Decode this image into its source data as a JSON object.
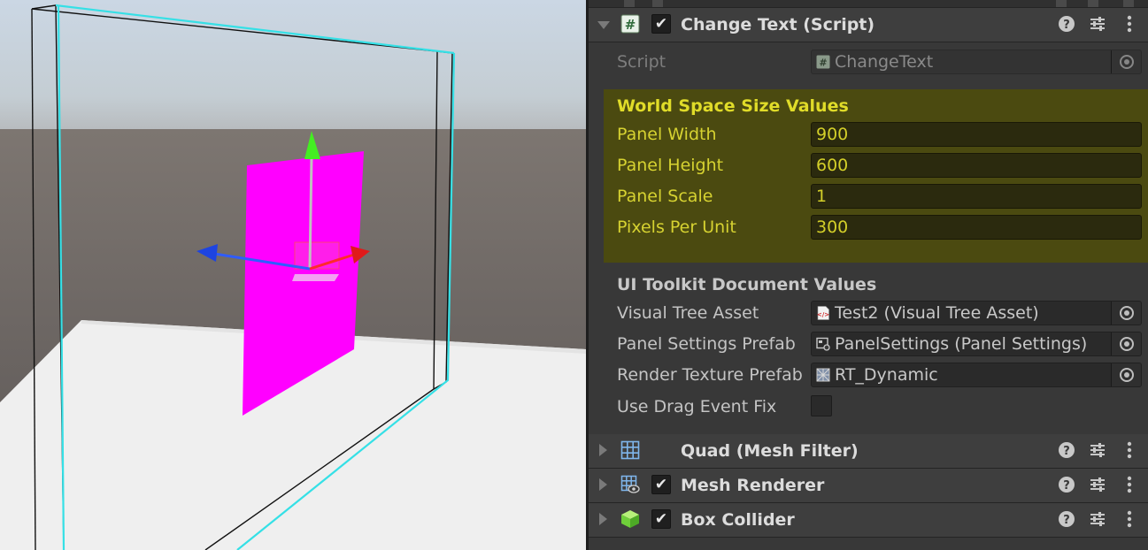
{
  "components": {
    "change_text": {
      "title": "Change Text (Script)",
      "script_label": "Script",
      "script_value": "ChangeText",
      "world_space": {
        "header": "World Space Size Values",
        "rows": [
          {
            "label": "Panel Width",
            "value": "900"
          },
          {
            "label": "Panel Height",
            "value": "600"
          },
          {
            "label": "Panel Scale",
            "value": "1"
          },
          {
            "label": "Pixels Per Unit",
            "value": "300"
          }
        ]
      },
      "ui_toolkit": {
        "header": "UI Toolkit Document Values",
        "visual_tree_label": "Visual Tree Asset",
        "visual_tree_value": "Test2 (Visual Tree Asset)",
        "panel_settings_label": "Panel Settings Prefab",
        "panel_settings_value": "PanelSettings (Panel Settings)",
        "render_texture_label": "Render Texture Prefab",
        "render_texture_value": "RT_Dynamic",
        "drag_fix_label": "Use Drag Event Fix"
      }
    },
    "quad_mesh_filter": {
      "title": "Quad (Mesh Filter)"
    },
    "mesh_renderer": {
      "title": "Mesh Renderer"
    },
    "box_collider": {
      "title": "Box Collider"
    }
  },
  "colors": {
    "highlight_bg": "#4b4a10",
    "highlight_text": "#d6d231",
    "panel_bg": "#383838",
    "magenta_quad": "#ff00ff",
    "selection_outline": "#35e0e6"
  },
  "icons": {
    "script": "hash-script-icon",
    "help": "help-icon",
    "presets": "sliders-icon",
    "menu": "kebab-menu-icon",
    "object_picker": "target-icon",
    "mesh_filter": "grid-mesh-icon",
    "mesh_renderer": "mesh-renderer-icon",
    "box_collider": "green-cube-icon"
  }
}
